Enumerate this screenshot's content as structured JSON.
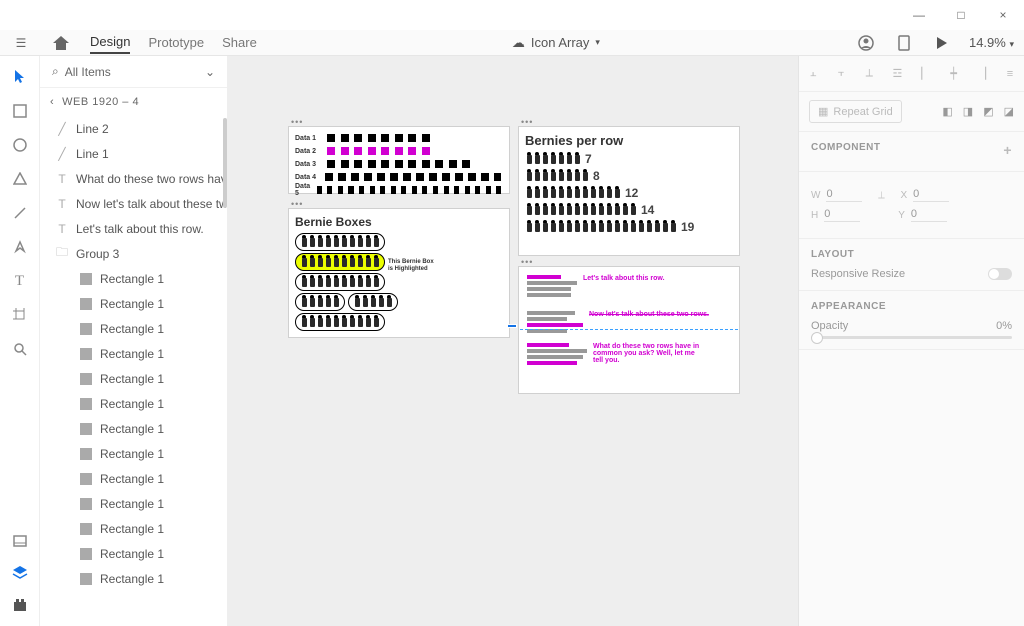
{
  "titlebar": {
    "min": "—",
    "max": "□",
    "close": "×"
  },
  "topbar": {
    "tabs": [
      "Design",
      "Prototype",
      "Share"
    ],
    "active": 0,
    "docname": "Icon Array",
    "zoom": "14.9%"
  },
  "allitems": {
    "label": "All Items",
    "search": "⌕"
  },
  "crumb": "WEB 1920 – 4",
  "layers": [
    {
      "t": "line",
      "n": "Line 2"
    },
    {
      "t": "line",
      "n": "Line 1"
    },
    {
      "t": "text",
      "n": "What do these two rows have in…"
    },
    {
      "t": "text",
      "n": "Now let's talk about these two ro…"
    },
    {
      "t": "text",
      "n": "Let's talk about this row."
    },
    {
      "t": "folder",
      "n": "Group 3"
    },
    {
      "t": "rect",
      "n": "Rectangle 1"
    },
    {
      "t": "rect",
      "n": "Rectangle 1"
    },
    {
      "t": "rect",
      "n": "Rectangle 1"
    },
    {
      "t": "rect",
      "n": "Rectangle 1"
    },
    {
      "t": "rect",
      "n": "Rectangle 1"
    },
    {
      "t": "rect",
      "n": "Rectangle 1"
    },
    {
      "t": "rect",
      "n": "Rectangle 1"
    },
    {
      "t": "rect",
      "n": "Rectangle 1"
    },
    {
      "t": "rect",
      "n": "Rectangle 1"
    },
    {
      "t": "rect",
      "n": "Rectangle 1"
    },
    {
      "t": "rect",
      "n": "Rectangle 1"
    },
    {
      "t": "rect",
      "n": "Rectangle 1"
    },
    {
      "t": "rect",
      "n": "Rectangle 1"
    }
  ],
  "ab1": {
    "rows": [
      {
        "l": "Data 1",
        "n": 8,
        "c": "b"
      },
      {
        "l": "Data 2",
        "n": 8,
        "c": "m"
      },
      {
        "l": "Data 3",
        "n": 11,
        "c": "b"
      },
      {
        "l": "Data 4",
        "n": 14,
        "c": "b"
      },
      {
        "l": "Data 5",
        "n": 18,
        "c": "b"
      }
    ]
  },
  "ab2": {
    "title": "Bernie Boxes",
    "note1": "This Bernie Box",
    "note2": "is Highlighted",
    "counts": [
      10,
      10,
      10,
      10,
      10
    ]
  },
  "ab3": {
    "title": "Bernies per row",
    "rows": [
      7,
      8,
      12,
      14,
      19
    ]
  },
  "ab4": {
    "t1": "Let's talk about this row.",
    "t2": "Now let's talk about these two rows.",
    "t3": "What do these two rows have in common you ask?  Well, let me tell you."
  },
  "rpanel": {
    "repeat": "Repeat Grid",
    "component": "COMPONENT",
    "w": "0",
    "x": "0",
    "h": "0",
    "y": "0",
    "layout": "LAYOUT",
    "responsive": "Responsive Resize",
    "appearance": "APPEARANCE",
    "opacity_l": "Opacity",
    "opacity_v": "0%"
  }
}
